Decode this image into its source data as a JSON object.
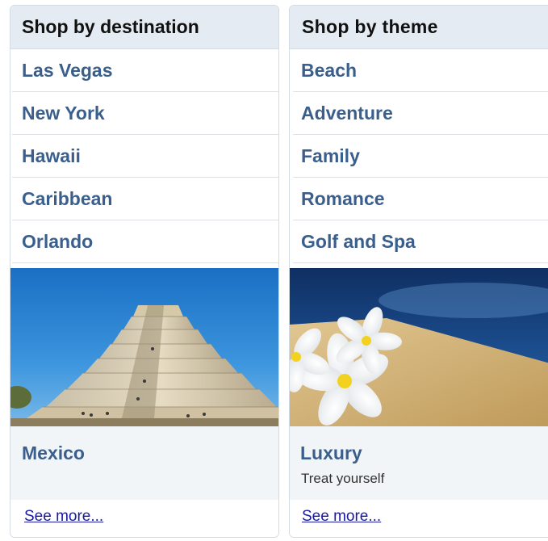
{
  "destination_panel": {
    "title": "Shop by destination",
    "links": [
      "Las Vegas",
      "New York",
      "Hawaii",
      "Caribbean",
      "Orlando"
    ],
    "feature": {
      "image_icon": "mayan-pyramid-photo",
      "title": "Mexico"
    },
    "see_more": "See more..."
  },
  "theme_panel": {
    "title": "Shop by theme",
    "links": [
      "Beach",
      "Adventure",
      "Family",
      "Romance",
      "Golf and Spa"
    ],
    "feature": {
      "image_icon": "plumeria-flowers-on-sand-photo",
      "title": "Luxury",
      "subtitle": "Treat yourself"
    },
    "see_more": "See more..."
  },
  "colors": {
    "header_bg": "#e4ebf2",
    "link_blue": "#3a5f8c",
    "see_more_link": "#1a1aa6",
    "caption_bg": "#f2f5f8"
  }
}
